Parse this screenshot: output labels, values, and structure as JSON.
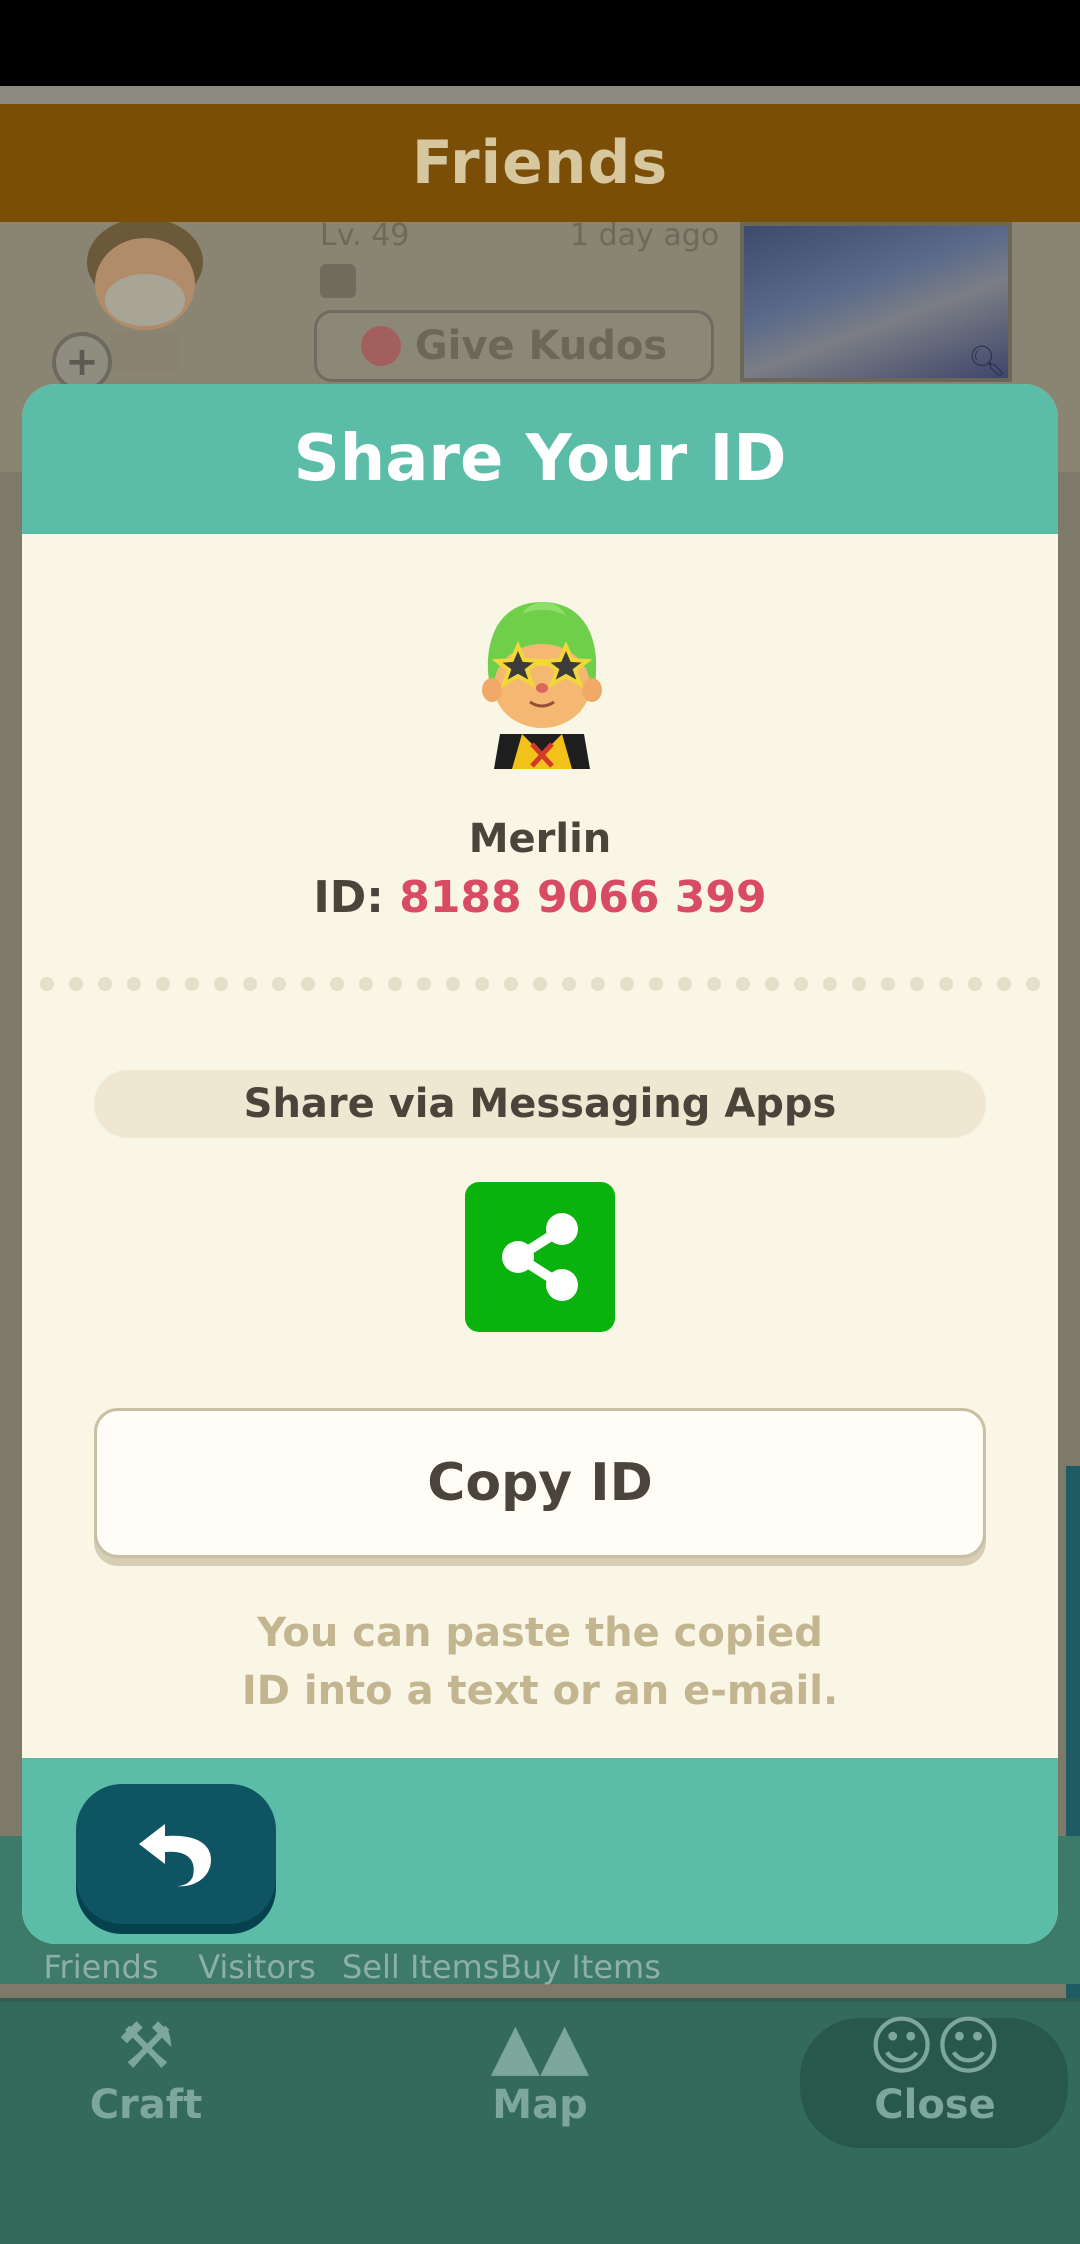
{
  "background": {
    "header_title": "Friends",
    "friend_card": {
      "level": "Lv. 49",
      "last_seen": "1 day ago",
      "kudos_label": "Give Kudos"
    },
    "subnav": [
      {
        "label": "Friends",
        "icon": "friends-icon",
        "active": true
      },
      {
        "label": "Visitors",
        "icon": "footprints-icon",
        "active": false
      },
      {
        "label": "Sell Items",
        "icon": "sell-bag-icon",
        "active": false
      },
      {
        "label": "Buy Items",
        "icon": "buy-bag-icon",
        "active": false
      }
    ],
    "mainnav": [
      {
        "label": "Craft",
        "icon": "hammer-icon"
      },
      {
        "label": "Map",
        "icon": "map-icon"
      },
      {
        "label": "Close",
        "icon": "characters-icon"
      }
    ]
  },
  "modal": {
    "title": "Share Your ID",
    "player_name": "Merlin",
    "id_prefix": "ID:",
    "id_value": "8188 9066 399",
    "share_label": "Share via Messaging Apps",
    "share_icon": "share-icon",
    "copy_label": "Copy ID",
    "hint_line1": "You can paste the copied",
    "hint_line2": "ID into a text or an e-mail.",
    "back_icon": "back-arrow-icon"
  },
  "colors": {
    "modal_header": "#5bbca8",
    "modal_body": "#f9f6e6",
    "id_value": "#d94a63",
    "share_button": "#09b20c",
    "back_button": "#0e5463",
    "app_header": "#7a4e06"
  }
}
